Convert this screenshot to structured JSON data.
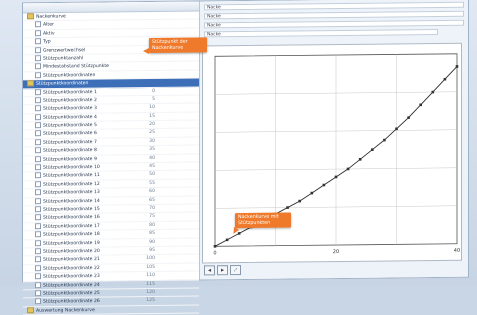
{
  "window": {
    "columns": [
      "",
      "",
      "",
      ""
    ]
  },
  "tree": {
    "rows": [
      {
        "label": "Nackenkurve",
        "c1": "",
        "c2": "",
        "c3": "",
        "kind": "folder"
      },
      {
        "label": "Alter",
        "c1": "",
        "c2": "",
        "c3": "",
        "kind": "item"
      },
      {
        "label": "Aktiv",
        "c1": "",
        "c2": "",
        "c3": "",
        "kind": "item"
      },
      {
        "label": "Typ",
        "c1": "",
        "c2": "",
        "c3": "",
        "kind": "item"
      },
      {
        "label": "Grenzwertwechsel",
        "c1": "",
        "c2": "",
        "c3": "",
        "kind": "item"
      },
      {
        "label": "Stützpunktanzahl",
        "c1": "",
        "c2": "",
        "c3": "",
        "kind": "item"
      },
      {
        "label": "Mindestabstand Stützpunkte",
        "c1": "",
        "c2": "",
        "c3": "",
        "kind": "item"
      },
      {
        "label": "Stützpunktkoordinaten",
        "c1": "",
        "c2": "",
        "c3": "",
        "kind": "item"
      },
      {
        "label": "Stützpunktkoordinaten",
        "c1": "",
        "c2": "",
        "c3": "",
        "kind": "folder",
        "selected": true
      },
      {
        "label": "Stützpunktkoordinate 1",
        "c1": "0",
        "c2": "",
        "c3": "",
        "kind": "item"
      },
      {
        "label": "Stützpunktkoordinate 2",
        "c1": "5",
        "c2": "",
        "c3": "",
        "kind": "item"
      },
      {
        "label": "Stützpunktkoordinate 3",
        "c1": "10",
        "c2": "",
        "c3": "",
        "kind": "item"
      },
      {
        "label": "Stützpunktkoordinate 4",
        "c1": "15",
        "c2": "",
        "c3": "",
        "kind": "item"
      },
      {
        "label": "Stützpunktkoordinate 5",
        "c1": "20",
        "c2": "",
        "c3": "",
        "kind": "item"
      },
      {
        "label": "Stützpunktkoordinate 6",
        "c1": "25",
        "c2": "",
        "c3": "",
        "kind": "item"
      },
      {
        "label": "Stützpunktkoordinate 7",
        "c1": "30",
        "c2": "",
        "c3": "",
        "kind": "item"
      },
      {
        "label": "Stützpunktkoordinate 8",
        "c1": "35",
        "c2": "",
        "c3": "",
        "kind": "item"
      },
      {
        "label": "Stützpunktkoordinate 9",
        "c1": "40",
        "c2": "",
        "c3": "",
        "kind": "item"
      },
      {
        "label": "Stützpunktkoordinate 10",
        "c1": "45",
        "c2": "",
        "c3": "",
        "kind": "item"
      },
      {
        "label": "Stützpunktkoordinate 11",
        "c1": "50",
        "c2": "",
        "c3": "",
        "kind": "item"
      },
      {
        "label": "Stützpunktkoordinate 12",
        "c1": "55",
        "c2": "",
        "c3": "",
        "kind": "item"
      },
      {
        "label": "Stützpunktkoordinate 13",
        "c1": "60",
        "c2": "",
        "c3": "",
        "kind": "item"
      },
      {
        "label": "Stützpunktkoordinate 14",
        "c1": "65",
        "c2": "",
        "c3": "",
        "kind": "item"
      },
      {
        "label": "Stützpunktkoordinate 15",
        "c1": "70",
        "c2": "",
        "c3": "",
        "kind": "item"
      },
      {
        "label": "Stützpunktkoordinate 16",
        "c1": "75",
        "c2": "",
        "c3": "",
        "kind": "item"
      },
      {
        "label": "Stützpunktkoordinate 17",
        "c1": "80",
        "c2": "",
        "c3": "",
        "kind": "item"
      },
      {
        "label": "Stützpunktkoordinate 18",
        "c1": "85",
        "c2": "",
        "c3": "",
        "kind": "item"
      },
      {
        "label": "Stützpunktkoordinate 19",
        "c1": "90",
        "c2": "",
        "c3": "",
        "kind": "item"
      },
      {
        "label": "Stützpunktkoordinate 20",
        "c1": "95",
        "c2": "",
        "c3": "",
        "kind": "item"
      },
      {
        "label": "Stützpunktkoordinate 21",
        "c1": "100",
        "c2": "",
        "c3": "",
        "kind": "item"
      },
      {
        "label": "Stützpunktkoordinate 22",
        "c1": "105",
        "c2": "",
        "c3": "",
        "kind": "item"
      },
      {
        "label": "Stützpunktkoordinate 23",
        "c1": "110",
        "c2": "",
        "c3": "",
        "kind": "item"
      },
      {
        "label": "Stützpunktkoordinate 24",
        "c1": "115",
        "c2": "",
        "c3": "",
        "kind": "item"
      },
      {
        "label": "Stützpunktkoordinate 25",
        "c1": "120",
        "c2": "",
        "c3": "",
        "kind": "item"
      },
      {
        "label": "Stützpunktkoordinate 26",
        "c1": "125",
        "c2": "",
        "c3": "",
        "kind": "item"
      },
      {
        "label": "Auswertung Nackenkurve",
        "c1": "",
        "c2": "",
        "c3": "",
        "kind": "folder"
      }
    ]
  },
  "fields": [
    "Nacke",
    "Nacke",
    "Nacke",
    "Nacke"
  ],
  "callouts": {
    "top": "Stützpunkt der Nackenkurve",
    "bottom": "Nackenkurve mit Stützpunkten"
  },
  "toolbar": [
    "◀",
    "▶",
    "⤢"
  ],
  "colors": {
    "accent": "#f07a2c",
    "selection": "#3d6fb8",
    "curve": "#2b2b2b"
  },
  "chart_data": {
    "type": "scatter",
    "title": "",
    "xlabel": "",
    "ylabel": "",
    "x": [
      0,
      2,
      4,
      6,
      8,
      10,
      12,
      14,
      16,
      18,
      20,
      22,
      24,
      26,
      28,
      30,
      32,
      34,
      36,
      38,
      40
    ],
    "y": [
      0,
      4,
      8,
      12,
      16,
      20,
      24,
      28,
      33,
      38,
      43,
      48,
      54,
      60,
      66,
      73,
      80,
      88,
      96,
      104,
      112
    ],
    "xlim": [
      0,
      40
    ],
    "ylim": [
      0,
      120
    ],
    "xticks": [
      "0",
      "",
      "20",
      "",
      "40"
    ],
    "yticks": [
      "",
      "",
      "",
      "",
      "",
      ""
    ],
    "grid": true
  }
}
